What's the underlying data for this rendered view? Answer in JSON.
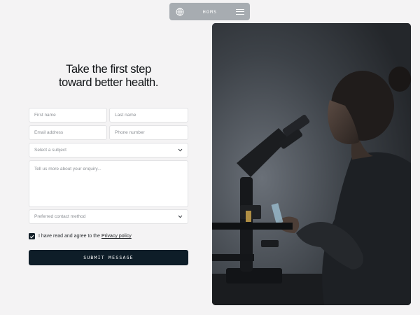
{
  "nav": {
    "brand": "HOMS",
    "logo_icon": "globe-logo-icon",
    "menu_icon": "hamburger-menu-icon"
  },
  "hero": {
    "headline_line1": "Take the first step",
    "headline_line2": "toward better health."
  },
  "form": {
    "first_name_placeholder": "First name",
    "last_name_placeholder": "Last name",
    "email_placeholder": "Email address",
    "phone_placeholder": "Phone number",
    "subject_placeholder": "Select a subject",
    "enquiry_placeholder": "Tell us more about your enquiry...",
    "contact_method_placeholder": "Preferred contact method",
    "agree_text": "I have read and agree to the",
    "privacy_link": "Privacy policy",
    "agree_checked": true,
    "submit_label": "SUBMIT MESSAGE"
  },
  "colors": {
    "background": "#f4f3f4",
    "nav": "#a7acb1",
    "button": "#0e1d28"
  }
}
